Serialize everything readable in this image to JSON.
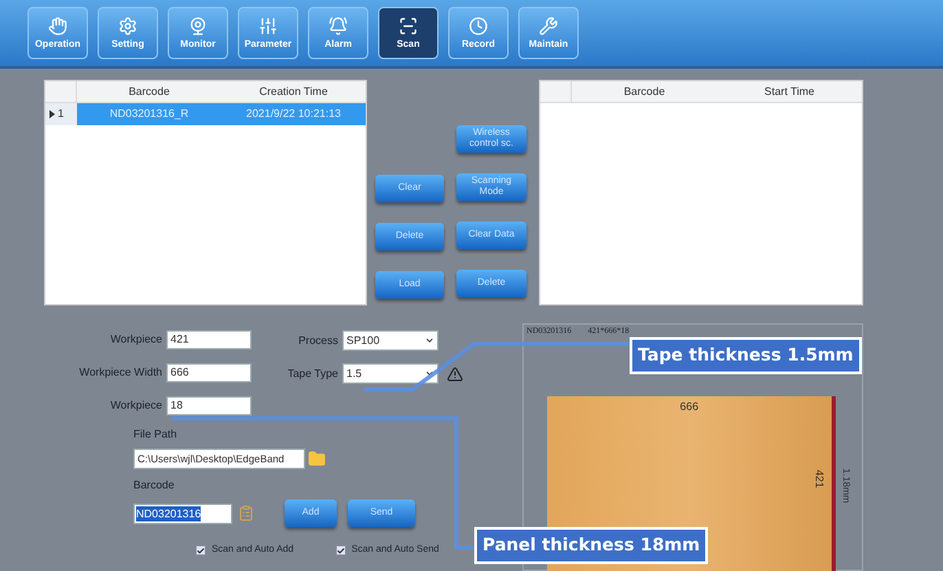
{
  "toolbar": [
    {
      "label": "Operation",
      "selected": false
    },
    {
      "label": "Setting",
      "selected": false
    },
    {
      "label": "Monitor",
      "selected": false
    },
    {
      "label": "Parameter",
      "selected": false
    },
    {
      "label": "Alarm",
      "selected": false
    },
    {
      "label": "Scan",
      "selected": true
    },
    {
      "label": "Record",
      "selected": false
    },
    {
      "label": "Maintain",
      "selected": false
    }
  ],
  "task_table": {
    "columns": [
      "Barcode",
      "Creation Time"
    ],
    "rows": [
      {
        "index": "1",
        "selected": true,
        "cells": [
          "ND03201316_R",
          "2021/9/22 10:21:13"
        ]
      }
    ]
  },
  "buttons_left": [
    "Clear",
    "Delete",
    "Load"
  ],
  "buttons_right": [
    "Wireless control sc.",
    "Scanning Mode",
    "Clear Data",
    "Delete"
  ],
  "scan_table": {
    "columns": [
      "Barcode",
      "Start Time"
    ]
  },
  "form": {
    "workpiece_length": {
      "label": "Workpiece",
      "value": "421"
    },
    "workpiece_width": {
      "label": "Workpiece Width",
      "value": "666"
    },
    "workpiece_thickness": {
      "label": "Workpiece",
      "value": "18"
    },
    "process": {
      "label": "Process",
      "value": "SP100"
    },
    "tape_type": {
      "label": "Tape Type",
      "value": "1.5"
    },
    "file_path": {
      "label": "File Path",
      "value": "C:\\Users\\wjl\\Desktop\\EdgeBand"
    },
    "barcode": {
      "label": "Barcode",
      "value": "ND03201316"
    },
    "actions": [
      "Add",
      "Send"
    ],
    "options": [
      {
        "label": "Scan and Auto Add",
        "checked": true
      },
      {
        "label": "Scan and Auto Send",
        "checked": true
      }
    ]
  },
  "preview": {
    "barcode": "ND03201316",
    "size": "421*666*18",
    "top_dimension": "666",
    "side_dimension": "421",
    "edge_label": "1.18mm"
  },
  "annotations": [
    "Tape thickness 1.5mm",
    "Panel thickness 18mm"
  ]
}
